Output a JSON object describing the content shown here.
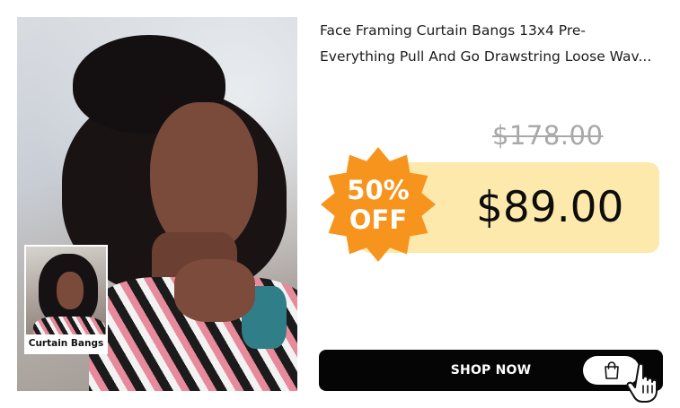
{
  "product": {
    "title_line1": "Face Framing Curtain Bangs 13x4 Pre-",
    "title_line2": "Everything Pull And Go Drawstring Loose Wav...",
    "thumbnail_label": "Curtain Bangs"
  },
  "pricing": {
    "old_price": "$178.00",
    "new_price": "$89.00",
    "discount_line1": "50%",
    "discount_line2": "OFF"
  },
  "actions": {
    "shop_now_label": "SHOP NOW"
  },
  "icons": {
    "cart": "shopping-bag-icon",
    "cursor": "hand-pointer-icon",
    "badge": "starburst-badge"
  },
  "colors": {
    "badge_orange": "#f7941d",
    "price_box": "#fde9ab",
    "button_black": "#050505",
    "old_price_gray": "#a8a8a8"
  }
}
